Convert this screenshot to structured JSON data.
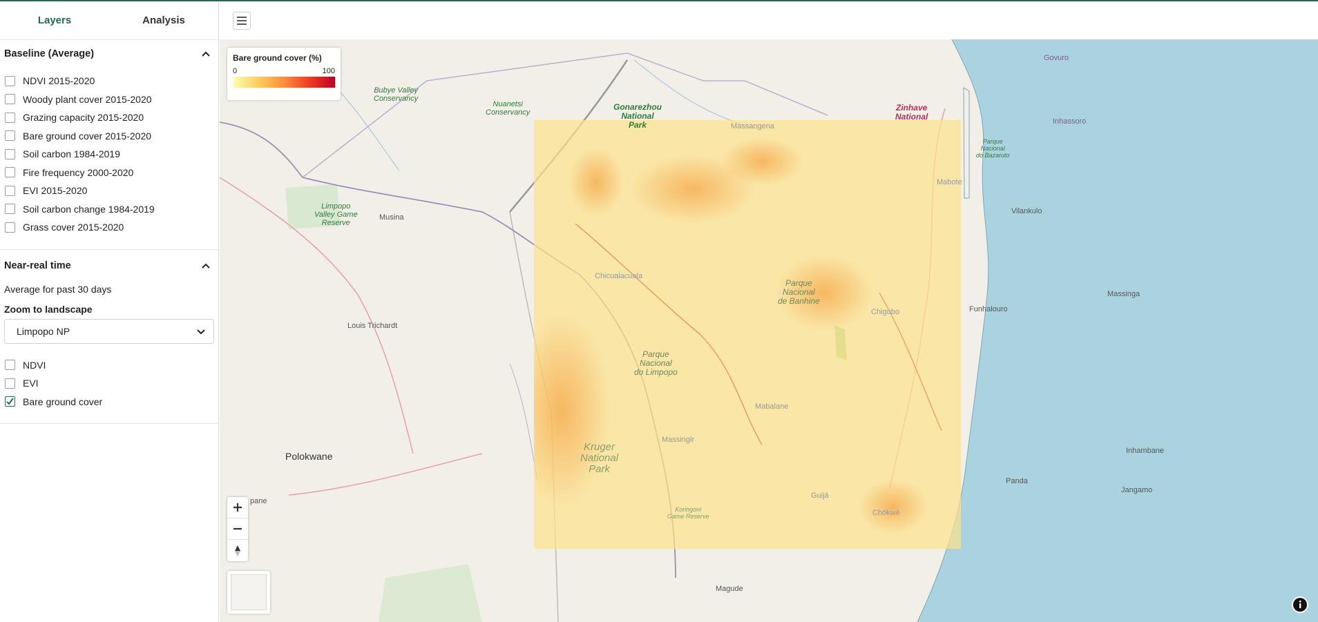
{
  "tabs": [
    {
      "label": "Layers"
    },
    {
      "label": "Analysis"
    }
  ],
  "baseline": {
    "title": "Baseline (Average)",
    "items": [
      {
        "label": "NDVI 2015-2020",
        "checked": false
      },
      {
        "label": "Woody plant cover 2015-2020",
        "checked": false
      },
      {
        "label": "Grazing capacity 2015-2020",
        "checked": false
      },
      {
        "label": "Bare ground cover 2015-2020",
        "checked": false
      },
      {
        "label": "Soil carbon 1984-2019",
        "checked": false
      },
      {
        "label": "Fire frequency 2000-2020",
        "checked": false
      },
      {
        "label": "EVI 2015-2020",
        "checked": false
      },
      {
        "label": "Soil carbon change 1984-2019",
        "checked": false
      },
      {
        "label": "Grass cover 2015-2020",
        "checked": false
      }
    ]
  },
  "nrt": {
    "title": "Near-real time",
    "subtitle": "Average for past 30 days",
    "zoom_label": "Zoom to landscape",
    "zoom_value": "Limpopo NP",
    "items": [
      {
        "label": "NDVI",
        "checked": false
      },
      {
        "label": "EVI",
        "checked": false
      },
      {
        "label": "Bare ground cover",
        "checked": true
      }
    ]
  },
  "legend": {
    "title": "Bare ground cover (%)",
    "min": "0",
    "max": "100"
  },
  "map_labels": {
    "polokwane": "Polokwane",
    "louis_trichardt": "Louis Trichardt",
    "musina": "Musina",
    "inhassoro": "Inhassoro",
    "vilankulo": "Vilankulo",
    "massinga": "Massinga",
    "funhalouro": "Funhalouro",
    "inhambane": "Inhambane",
    "jangamo": "Jangamo",
    "panda": "Panda",
    "magude": "Magude",
    "govuro": "Govuro",
    "pane": "pane",
    "mabote": "Mabote",
    "chicualacuala": "Chicualacuala",
    "chigubo": "Chigubo",
    "mabalane": "Mabalane",
    "massingir": "Massingir",
    "guija": "Guijá",
    "chokwe": "Chókwè",
    "massangena": "Massangena",
    "bubye": "Bubye Valley\nConservancy",
    "nuanetsi": "Nuanetsi\nConservancy",
    "gonarezhou": "Gonarezhou\nNational\nPark",
    "zinhave": "Zinhave\nNational",
    "limpopo_valley": "Limpopo\nValley Game\nReserve",
    "banhine": "Parque\nNacional\nde Banhine",
    "limpopo_np": "Parque\nNacional\ndo Limpopo",
    "kruger": "Kruger\nNational\nPark",
    "koringoni": "Koringoni\nGame Reserve",
    "bazaruto": "Parque\nNacional\ndo Bazaruto"
  },
  "colors": {
    "accent": "#1f6b4d",
    "sea": "#aad3df",
    "land": "#f2efe9"
  },
  "icons": {
    "menu": "hamburger-icon",
    "collapse": "chevron-up-icon",
    "select": "chevron-down-icon",
    "check": "check-icon",
    "info": "info-icon",
    "reset_north": "compass-icon"
  }
}
